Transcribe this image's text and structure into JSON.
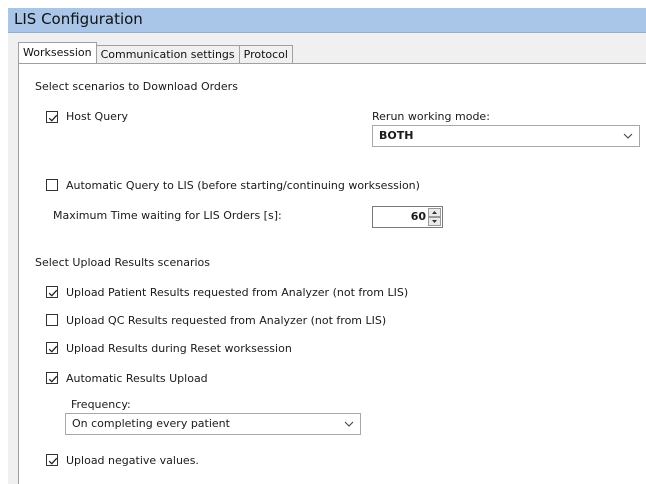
{
  "window": {
    "title": "LIS Configuration"
  },
  "tabs": [
    {
      "label": "Worksession",
      "active": true
    },
    {
      "label": "Communication settings",
      "active": false
    },
    {
      "label": "Protocol",
      "active": false
    }
  ],
  "download": {
    "section_title": "Select scenarios to Download Orders",
    "host_query": {
      "label": "Host Query",
      "checked": true
    },
    "rerun_mode": {
      "label": "Rerun working mode:",
      "value": "BOTH"
    },
    "auto_query": {
      "label": "Automatic Query to LIS (before starting/continuing worksession)",
      "checked": false
    },
    "max_time": {
      "label": "Maximum Time waiting for LIS Orders [s]:",
      "value": "60"
    }
  },
  "upload": {
    "section_title": "Select Upload Results scenarios",
    "patient_results": {
      "label": "Upload Patient Results requested from Analyzer (not from LIS)",
      "checked": true
    },
    "qc_results": {
      "label": "Upload QC Results requested from Analyzer (not from LIS)",
      "checked": false
    },
    "reset_results": {
      "label": "Upload Results during Reset worksession",
      "checked": true
    },
    "auto_upload": {
      "label": "Automatic Results Upload",
      "checked": true
    },
    "frequency": {
      "label": "Frequency:",
      "value": "On completing every patient"
    },
    "negative_values": {
      "label": "Upload negative values.",
      "checked": true
    }
  },
  "colors": {
    "title_bar": "#a9c6e8",
    "panel": "#ffffff",
    "frame": "#f0f0f0"
  }
}
